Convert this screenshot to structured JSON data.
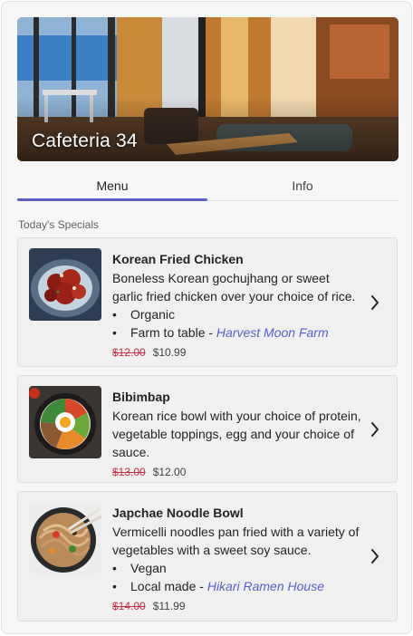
{
  "hero": {
    "title": "Cafeteria 34"
  },
  "tabs": [
    {
      "label": "Menu",
      "active": true
    },
    {
      "label": "Info",
      "active": false
    }
  ],
  "section": {
    "label": "Today's Specials"
  },
  "items": [
    {
      "name": "Korean Fried Chicken",
      "description": "Boneless Korean gochujhang or sweet garlic fried chicken over your choice of rice.",
      "bullets": [
        {
          "text": "Organic"
        },
        {
          "text": "Farm to table - ",
          "link": "Harvest Moon Farm"
        }
      ],
      "old_price": "$12.00",
      "new_price": "$10.99",
      "image": "korean-fried-chicken-photo"
    },
    {
      "name": "Bibimbap",
      "description": "Korean rice bowl with your choice of protein, vegetable toppings, egg and your choice of sauce.",
      "old_price": "$13.00",
      "new_price": "$12.00",
      "image": "bibimbap-photo"
    },
    {
      "name": "Japchae Noodle Bowl",
      "description": "Vermicelli noodles pan fried with a variety of vegetables with a sweet soy sauce.",
      "bullets": [
        {
          "text": "Vegan"
        },
        {
          "text": "Local made - ",
          "link": "Hikari Ramen House"
        }
      ],
      "old_price": "$14.00",
      "new_price": "$11.99",
      "image": "japchae-photo"
    }
  ],
  "colors": {
    "accent": "#5b5fc7",
    "old_price": "#c4314b",
    "card_bg": "#f0f0f0"
  },
  "icons": {
    "item_arrow": "chevron-right-icon"
  }
}
